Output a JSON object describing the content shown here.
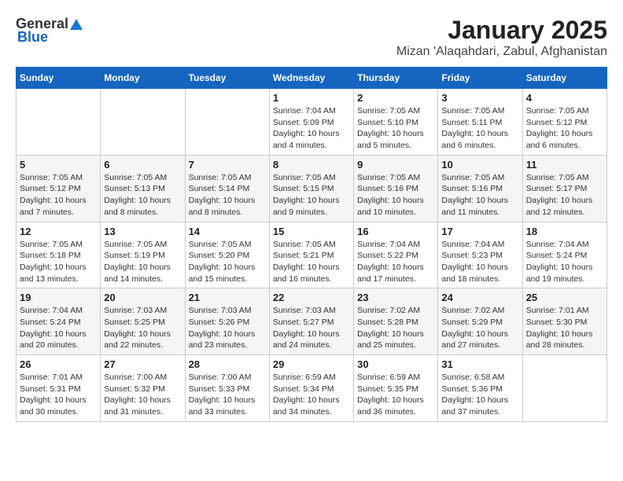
{
  "header": {
    "logo_general": "General",
    "logo_blue": "Blue",
    "title": "January 2025",
    "subtitle": "Mizan 'Alaqahdari, Zabul, Afghanistan"
  },
  "calendar": {
    "days_of_week": [
      "Sunday",
      "Monday",
      "Tuesday",
      "Wednesday",
      "Thursday",
      "Friday",
      "Saturday"
    ],
    "weeks": [
      [
        {
          "day": "",
          "info": ""
        },
        {
          "day": "",
          "info": ""
        },
        {
          "day": "",
          "info": ""
        },
        {
          "day": "1",
          "info": "Sunrise: 7:04 AM\nSunset: 5:09 PM\nDaylight: 10 hours\nand 4 minutes."
        },
        {
          "day": "2",
          "info": "Sunrise: 7:05 AM\nSunset: 5:10 PM\nDaylight: 10 hours\nand 5 minutes."
        },
        {
          "day": "3",
          "info": "Sunrise: 7:05 AM\nSunset: 5:11 PM\nDaylight: 10 hours\nand 6 minutes."
        },
        {
          "day": "4",
          "info": "Sunrise: 7:05 AM\nSunset: 5:12 PM\nDaylight: 10 hours\nand 6 minutes."
        }
      ],
      [
        {
          "day": "5",
          "info": "Sunrise: 7:05 AM\nSunset: 5:12 PM\nDaylight: 10 hours\nand 7 minutes."
        },
        {
          "day": "6",
          "info": "Sunrise: 7:05 AM\nSunset: 5:13 PM\nDaylight: 10 hours\nand 8 minutes."
        },
        {
          "day": "7",
          "info": "Sunrise: 7:05 AM\nSunset: 5:14 PM\nDaylight: 10 hours\nand 8 minutes."
        },
        {
          "day": "8",
          "info": "Sunrise: 7:05 AM\nSunset: 5:15 PM\nDaylight: 10 hours\nand 9 minutes."
        },
        {
          "day": "9",
          "info": "Sunrise: 7:05 AM\nSunset: 5:16 PM\nDaylight: 10 hours\nand 10 minutes."
        },
        {
          "day": "10",
          "info": "Sunrise: 7:05 AM\nSunset: 5:16 PM\nDaylight: 10 hours\nand 11 minutes."
        },
        {
          "day": "11",
          "info": "Sunrise: 7:05 AM\nSunset: 5:17 PM\nDaylight: 10 hours\nand 12 minutes."
        }
      ],
      [
        {
          "day": "12",
          "info": "Sunrise: 7:05 AM\nSunset: 5:18 PM\nDaylight: 10 hours\nand 13 minutes."
        },
        {
          "day": "13",
          "info": "Sunrise: 7:05 AM\nSunset: 5:19 PM\nDaylight: 10 hours\nand 14 minutes."
        },
        {
          "day": "14",
          "info": "Sunrise: 7:05 AM\nSunset: 5:20 PM\nDaylight: 10 hours\nand 15 minutes."
        },
        {
          "day": "15",
          "info": "Sunrise: 7:05 AM\nSunset: 5:21 PM\nDaylight: 10 hours\nand 16 minutes."
        },
        {
          "day": "16",
          "info": "Sunrise: 7:04 AM\nSunset: 5:22 PM\nDaylight: 10 hours\nand 17 minutes."
        },
        {
          "day": "17",
          "info": "Sunrise: 7:04 AM\nSunset: 5:23 PM\nDaylight: 10 hours\nand 18 minutes."
        },
        {
          "day": "18",
          "info": "Sunrise: 7:04 AM\nSunset: 5:24 PM\nDaylight: 10 hours\nand 19 minutes."
        }
      ],
      [
        {
          "day": "19",
          "info": "Sunrise: 7:04 AM\nSunset: 5:24 PM\nDaylight: 10 hours\nand 20 minutes."
        },
        {
          "day": "20",
          "info": "Sunrise: 7:03 AM\nSunset: 5:25 PM\nDaylight: 10 hours\nand 22 minutes."
        },
        {
          "day": "21",
          "info": "Sunrise: 7:03 AM\nSunset: 5:26 PM\nDaylight: 10 hours\nand 23 minutes."
        },
        {
          "day": "22",
          "info": "Sunrise: 7:03 AM\nSunset: 5:27 PM\nDaylight: 10 hours\nand 24 minutes."
        },
        {
          "day": "23",
          "info": "Sunrise: 7:02 AM\nSunset: 5:28 PM\nDaylight: 10 hours\nand 25 minutes."
        },
        {
          "day": "24",
          "info": "Sunrise: 7:02 AM\nSunset: 5:29 PM\nDaylight: 10 hours\nand 27 minutes."
        },
        {
          "day": "25",
          "info": "Sunrise: 7:01 AM\nSunset: 5:30 PM\nDaylight: 10 hours\nand 28 minutes."
        }
      ],
      [
        {
          "day": "26",
          "info": "Sunrise: 7:01 AM\nSunset: 5:31 PM\nDaylight: 10 hours\nand 30 minutes."
        },
        {
          "day": "27",
          "info": "Sunrise: 7:00 AM\nSunset: 5:32 PM\nDaylight: 10 hours\nand 31 minutes."
        },
        {
          "day": "28",
          "info": "Sunrise: 7:00 AM\nSunset: 5:33 PM\nDaylight: 10 hours\nand 33 minutes."
        },
        {
          "day": "29",
          "info": "Sunrise: 6:59 AM\nSunset: 5:34 PM\nDaylight: 10 hours\nand 34 minutes."
        },
        {
          "day": "30",
          "info": "Sunrise: 6:59 AM\nSunset: 5:35 PM\nDaylight: 10 hours\nand 36 minutes."
        },
        {
          "day": "31",
          "info": "Sunrise: 6:58 AM\nSunset: 5:36 PM\nDaylight: 10 hours\nand 37 minutes."
        },
        {
          "day": "",
          "info": ""
        }
      ]
    ]
  }
}
